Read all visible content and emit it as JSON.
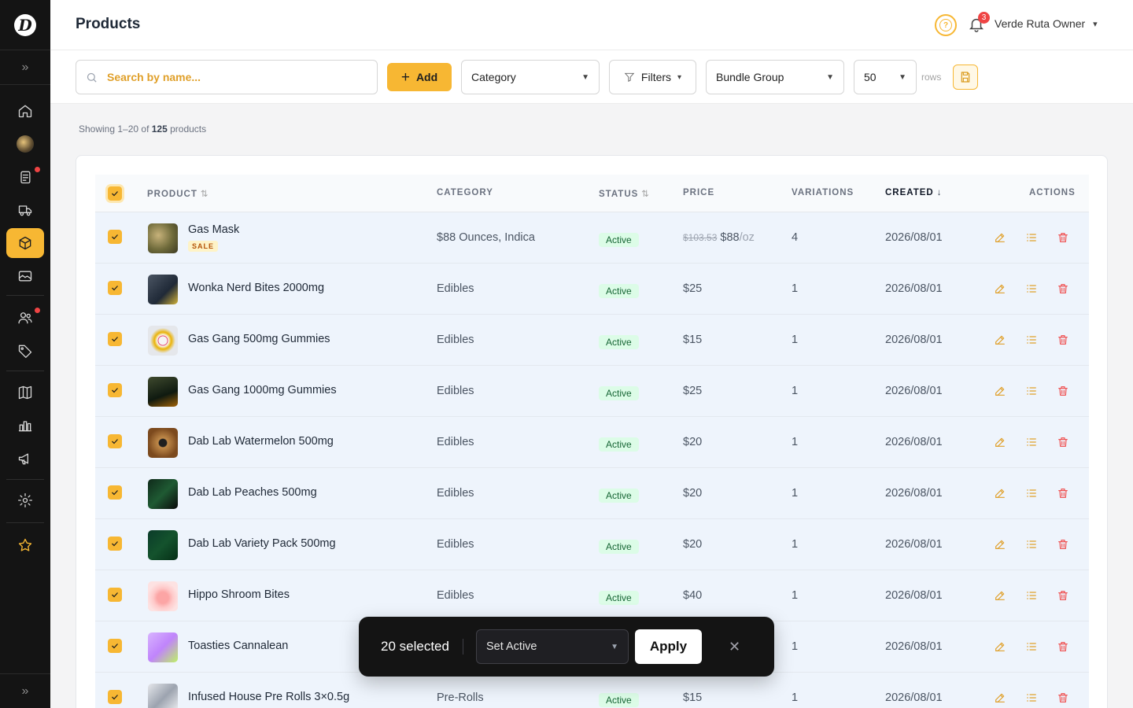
{
  "header": {
    "title": "Products",
    "notifications": "3",
    "user": "Verde Ruta Owner"
  },
  "toolbar": {
    "search_placeholder": "Search by name...",
    "add_label": "Add",
    "category_label": "Category",
    "filters_label": "Filters",
    "bundle_label": "Bundle Group",
    "rows_value": "50",
    "rows_label": "rows"
  },
  "showing": {
    "prefix": "Showing 1–20 of ",
    "total": "125",
    "suffix": " products"
  },
  "table": {
    "columns": {
      "product": "PRODUCT",
      "category": "CATEGORY",
      "status": "STATUS",
      "price": "PRICE",
      "variations": "VARIATIONS",
      "created": "CREATED",
      "actions": "ACTIONS"
    },
    "sort": {
      "neutral": "⇅",
      "desc": "↓"
    },
    "rows": [
      {
        "name": "Gas Mask",
        "sale": "SALE",
        "category": "$88 Ounces, Indica",
        "status": "Active",
        "price_old": "$103.53",
        "price": "$88",
        "unit": "/oz",
        "variations": "4",
        "created": "2026/08/01"
      },
      {
        "name": "Wonka Nerd Bites 2000mg",
        "category": "Edibles",
        "status": "Active",
        "price": "$25",
        "variations": "1",
        "created": "2026/08/01"
      },
      {
        "name": "Gas Gang 500mg Gummies",
        "category": "Edibles",
        "status": "Active",
        "price": "$15",
        "variations": "1",
        "created": "2026/08/01"
      },
      {
        "name": "Gas Gang 1000mg Gummies",
        "category": "Edibles",
        "status": "Active",
        "price": "$25",
        "variations": "1",
        "created": "2026/08/01"
      },
      {
        "name": "Dab Lab Watermelon 500mg",
        "category": "Edibles",
        "status": "Active",
        "price": "$20",
        "variations": "1",
        "created": "2026/08/01"
      },
      {
        "name": "Dab Lab Peaches 500mg",
        "category": "Edibles",
        "status": "Active",
        "price": "$20",
        "variations": "1",
        "created": "2026/08/01"
      },
      {
        "name": "Dab Lab Variety Pack 500mg",
        "category": "Edibles",
        "status": "Active",
        "price": "$20",
        "variations": "1",
        "created": "2026/08/01"
      },
      {
        "name": "Hippo Shroom Bites",
        "category": "Edibles",
        "status": "Active",
        "price": "$40",
        "variations": "1",
        "created": "2026/08/01"
      },
      {
        "name": "Toasties Cannalean",
        "category": "",
        "status": "",
        "price": "",
        "variations": "1",
        "created": "2026/08/01"
      },
      {
        "name": "Infused House Pre Rolls 3×0.5g",
        "category": "Pre-Rolls",
        "status": "Active",
        "price": "$15",
        "variations": "1",
        "created": "2026/08/01"
      }
    ]
  },
  "bulk": {
    "count": "20 selected",
    "action": "Set Active",
    "apply": "Apply"
  },
  "colors": {
    "accent": "#f7b733",
    "sidebar": "#141414",
    "danger": "#ef4444",
    "success": "#166534"
  },
  "icons": [
    "home-icon",
    "orders-icon",
    "delivery-icon",
    "products-icon",
    "media-icon",
    "customers-icon",
    "tag-icon",
    "catalog-icon",
    "analytics-icon",
    "megaphone-icon",
    "settings-icon",
    "star-icon",
    "bell-icon",
    "help-icon",
    "search-icon",
    "filter-icon",
    "save-icon",
    "edit-icon",
    "list-icon",
    "trash-icon"
  ]
}
